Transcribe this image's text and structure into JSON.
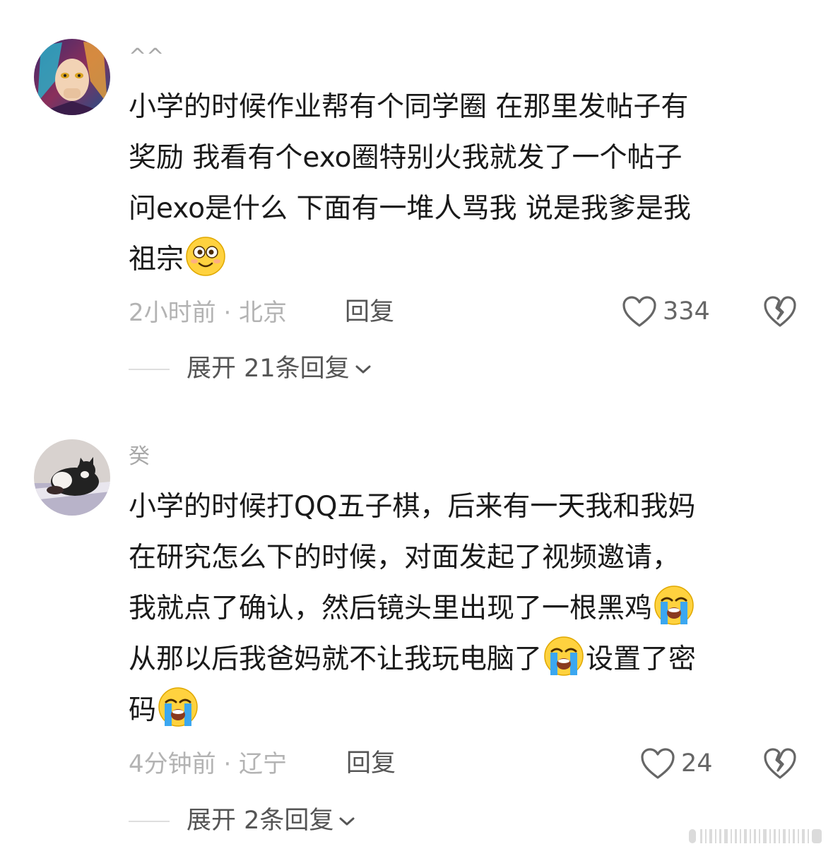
{
  "comments": [
    {
      "username": "^^",
      "avatar_icon": "anime-character-avatar",
      "lines": [
        "小学的时候作业帮有个同学圈 在那里发帖子有",
        "奖励 我看有个exo圈特别火我就发了一个帖子",
        "问exo是什么 下面有一堆人骂我 说是我爹是我",
        "祖宗"
      ],
      "emoji": "silly-face-emoji",
      "meta": "2小时前 · 北京",
      "reply_label": "回复",
      "like_count": "334",
      "expand_label": "展开 21条回复"
    },
    {
      "username": "癸",
      "avatar_icon": "cat-photo-avatar",
      "lines": [
        "小学的时候打QQ五子棋，后来有一天我和我妈",
        "在研究怎么下的时候，对面发起了视频邀请，",
        "我就点了确认，然后镜头里出现了一根黑鸡",
        "从那以后我爸妈就不让我玩电脑了",
        "设置了密",
        "码"
      ],
      "emoji": "loudly-crying-emoji",
      "meta": "4分钟前 · 辽宁",
      "reply_label": "回复",
      "like_count": "24",
      "expand_label": "展开 2条回复"
    }
  ],
  "icons": {
    "like": "heart-outline-icon",
    "dislike": "broken-heart-icon",
    "expand": "chevron-down-icon"
  },
  "colors": {
    "text": "#1a1a1a",
    "muted": "#b3b3b3",
    "action": "#555555"
  }
}
